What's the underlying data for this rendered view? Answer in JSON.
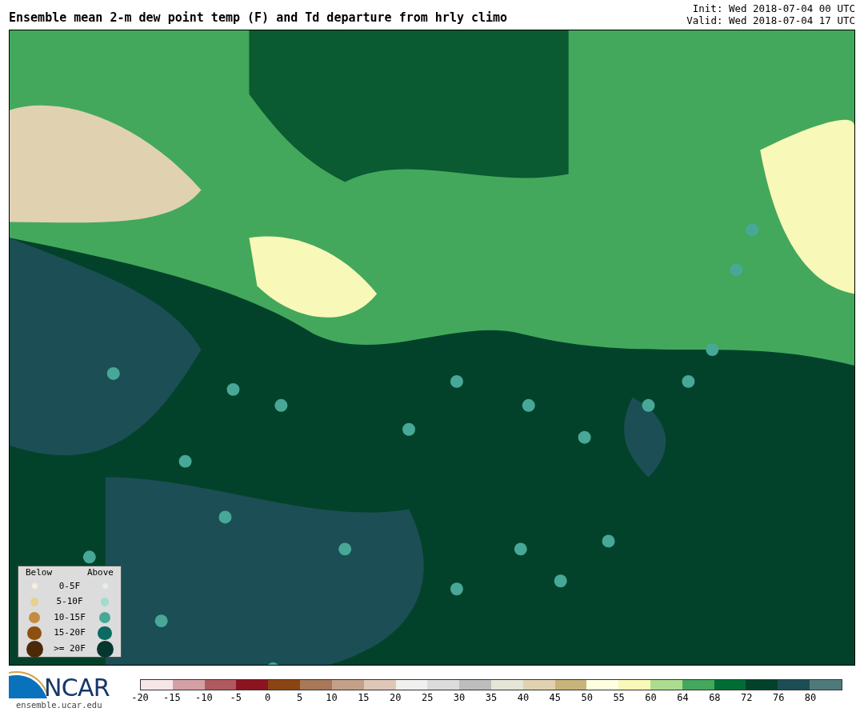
{
  "header": {
    "title": "Ensemble mean 2-m dew point temp (F) and Td departure from hrly climo",
    "init": "Init: Wed 2018-07-04 00 UTC",
    "valid": "Valid: Wed 2018-07-04 17 UTC"
  },
  "legend": {
    "below_label": "Below",
    "above_label": "Above",
    "rows": [
      {
        "label": "0-5F",
        "below": {
          "color": "#f7efdc"
        },
        "above": {
          "color": "#e0eeee"
        }
      },
      {
        "label": "5-10F",
        "below": {
          "color": "#e8d090"
        },
        "above": {
          "color": "#a0dcd0"
        }
      },
      {
        "label": "10-15F",
        "below": {
          "color": "#c48c40"
        },
        "above": {
          "color": "#48a898"
        }
      },
      {
        "label": "15-20F",
        "below": {
          "color": "#8c5010"
        },
        "above": {
          "color": "#0c6a60"
        }
      },
      {
        "label": ">= 20F",
        "below": {
          "color": "#4c2a08"
        },
        "above": {
          "color": "#06372f"
        }
      }
    ]
  },
  "logo": {
    "text": "NCAR",
    "url": "ensemble.ucar.edu"
  },
  "colorbar": {
    "bins": [
      {
        "color": "#f5e6e8"
      },
      {
        "color": "#d5a0a5"
      },
      {
        "color": "#b05a5f"
      },
      {
        "color": "#8b141f"
      },
      {
        "color": "#8b4513"
      },
      {
        "color": "#a87858"
      },
      {
        "color": "#c4a088"
      },
      {
        "color": "#dfc7b8"
      },
      {
        "color": "#f0f0ee"
      },
      {
        "color": "#dcdcdc"
      },
      {
        "color": "#bdbdbd"
      },
      {
        "color": "#e5e5d8"
      },
      {
        "color": "#e0d2b0"
      },
      {
        "color": "#c8b47a"
      },
      {
        "color": "#fefee0"
      },
      {
        "color": "#f8f8b8"
      },
      {
        "color": "#acdc8f"
      },
      {
        "color": "#43a85c"
      },
      {
        "color": "#006d35"
      },
      {
        "color": "#03422a"
      },
      {
        "color": "#1c4e55"
      },
      {
        "color": "#4f7a7c"
      }
    ],
    "ticks": [
      "-20",
      "-15",
      "-10",
      "-5",
      "0",
      "5",
      "10",
      "15",
      "20",
      "25",
      "30",
      "35",
      "40",
      "45",
      "50",
      "55",
      "60",
      "64",
      "68",
      "72",
      "76",
      "80"
    ]
  }
}
